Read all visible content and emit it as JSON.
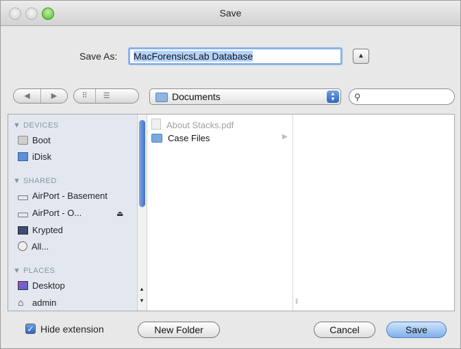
{
  "window": {
    "title": "Save"
  },
  "save_as": {
    "label": "Save As:",
    "value": "MacForensicsLab Database"
  },
  "toolbar": {
    "back_glyph": "◀",
    "forward_glyph": "▶",
    "view_icon_glyph": "⠿",
    "view_list_glyph": "☰",
    "view_column_glyph": "▥",
    "location": "Documents",
    "search_placeholder": ""
  },
  "sidebar": {
    "devices_header": "DEVICES",
    "devices": [
      "Boot",
      "iDisk"
    ],
    "shared_header": "SHARED",
    "shared": [
      "AirPort - Basement",
      "AirPort - O...",
      "Krypted",
      "All..."
    ],
    "places_header": "PLACES",
    "places": [
      "Desktop",
      "admin"
    ]
  },
  "files": [
    {
      "name": "About Stacks.pdf",
      "dimmed": true
    },
    {
      "name": "Case Files",
      "dimmed": false
    }
  ],
  "footer": {
    "hide_extension_label": "Hide extension",
    "hide_extension_checked": true,
    "new_folder_label": "New Folder",
    "cancel_label": "Cancel",
    "save_label": "Save"
  }
}
